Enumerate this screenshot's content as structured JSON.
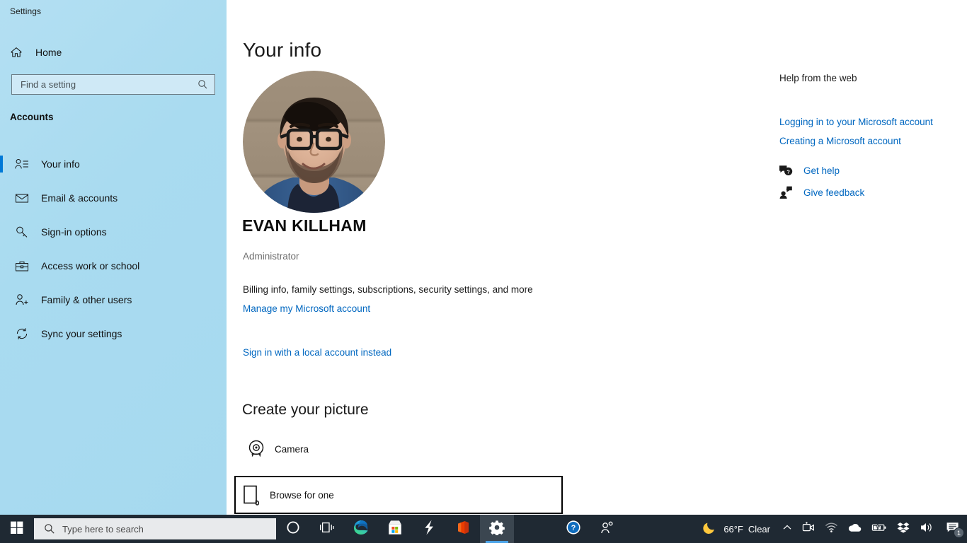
{
  "window": {
    "title": "Settings",
    "controls": {
      "minimize": "minimize-icon",
      "restore": "restore-icon",
      "close": "close-icon"
    }
  },
  "sidebar": {
    "home_label": "Home",
    "home_icon": "home-icon",
    "search": {
      "placeholder": "Find a setting",
      "value": "",
      "icon": "search-icon"
    },
    "section_title": "Accounts",
    "items": [
      {
        "label": "Your info",
        "icon": "person-info-icon",
        "active": true
      },
      {
        "label": "Email & accounts",
        "icon": "envelope-icon",
        "active": false
      },
      {
        "label": "Sign-in options",
        "icon": "key-icon",
        "active": false
      },
      {
        "label": "Access work or school",
        "icon": "briefcase-icon",
        "active": false
      },
      {
        "label": "Family & other users",
        "icon": "person-add-icon",
        "active": false
      },
      {
        "label": "Sync your settings",
        "icon": "sync-icon",
        "active": false
      }
    ]
  },
  "main": {
    "page_title": "Your info",
    "avatar_alt": "user-profile-photo",
    "user_name": "EVAN KILLHAM",
    "user_role": "Administrator",
    "billing_text": "Billing info, family settings, subscriptions, security settings, and more",
    "manage_link": "Manage my Microsoft account",
    "local_account_link": "Sign in with a local account instead",
    "create_picture": {
      "title": "Create your picture",
      "options": [
        {
          "label": "Camera",
          "icon": "camera-icon",
          "focused": false
        },
        {
          "label": "Browse for one",
          "icon": "file-icon",
          "focused": true
        }
      ]
    }
  },
  "help_rail": {
    "title": "Help from the web",
    "links": [
      "Logging in to your Microsoft account",
      "Creating a Microsoft account"
    ],
    "actions": [
      {
        "label": "Get help",
        "icon": "question-chat-icon"
      },
      {
        "label": "Give feedback",
        "icon": "feedback-icon"
      }
    ]
  },
  "taskbar": {
    "start_icon": "windows-start-icon",
    "search": {
      "placeholder": "Type here to search",
      "value": "",
      "icon": "search-icon"
    },
    "apps": [
      {
        "name": "cortana-icon",
        "active": false
      },
      {
        "name": "task-view-icon",
        "active": false
      },
      {
        "name": "microsoft-edge-icon",
        "active": false
      },
      {
        "name": "microsoft-store-icon",
        "active": false
      },
      {
        "name": "lightning-app-icon",
        "active": false
      },
      {
        "name": "microsoft-office-icon",
        "active": false
      },
      {
        "name": "settings-icon",
        "active": true
      }
    ],
    "middle_icons": [
      {
        "name": "help-circle-icon"
      },
      {
        "name": "people-icon"
      }
    ],
    "weather": {
      "icon": "moon-icon",
      "temperature": "66°F",
      "condition": "Clear"
    },
    "tray_icons": [
      {
        "name": "show-hidden-icons-chevron-icon"
      },
      {
        "name": "webcam-icon"
      },
      {
        "name": "wifi-icon"
      },
      {
        "name": "onedrive-cloud-icon"
      },
      {
        "name": "battery-icon"
      },
      {
        "name": "dropbox-icon"
      },
      {
        "name": "volume-icon"
      }
    ],
    "notifications": {
      "icon": "notification-center-icon",
      "count": "1"
    }
  },
  "colors": {
    "accent": "#0078d7",
    "link": "#0067c0",
    "sidebar_bg": "#abdcf0",
    "taskbar_bg": "#1f2933"
  }
}
